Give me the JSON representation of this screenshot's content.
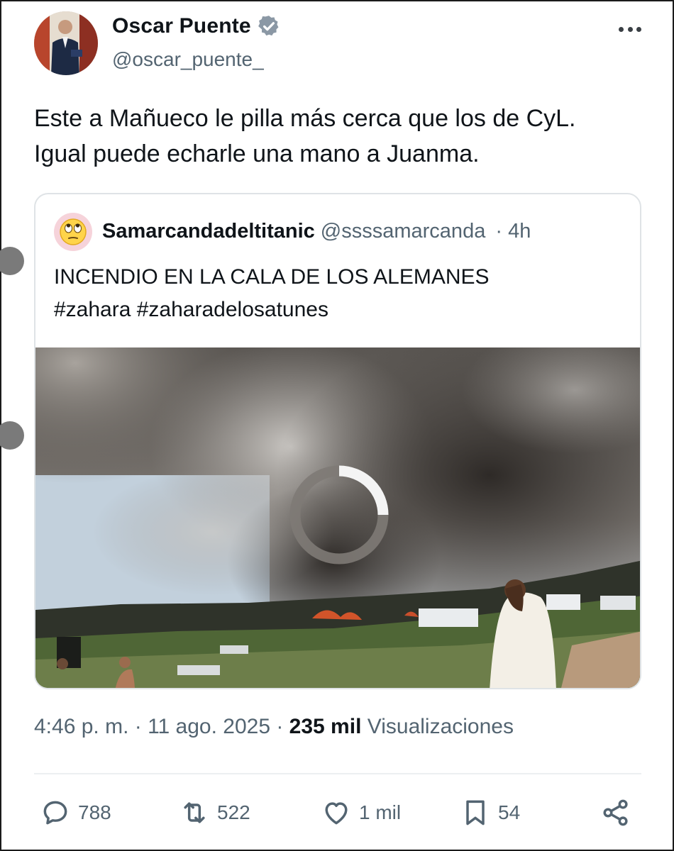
{
  "tweet": {
    "author": {
      "name": "Oscar Puente",
      "handle": "@oscar_puente_",
      "verified_icon": "verified-badge-icon"
    },
    "text_lines": [
      "Este a Mañueco le pilla más cerca que los de CyL.",
      "Igual puede echarle una mano a Juanma."
    ],
    "quoted": {
      "name": "Samarcandadeltitanic",
      "handle": "@ssssamarcanda",
      "time": "· 4h",
      "avatar_icon": "eye-roll-emoji-icon",
      "text_lines": [
        "INCENDIO EN LA CALA DE LOS ALEMANES",
        "#zahara #zaharadelosatunes"
      ]
    },
    "meta": {
      "time_date": "4:46 p. m. · 11 ago. 2025 ·",
      "views_count": "235 mil",
      "views_label": "Visualizaciones"
    },
    "actions": {
      "replies": "788",
      "reposts": "522",
      "likes": "1 mil",
      "bookmarks": "54"
    }
  },
  "colors": {
    "text": "#0f1419",
    "secondary": "#536471",
    "verified": "#8b98a5",
    "border": "#dfe3e6"
  }
}
